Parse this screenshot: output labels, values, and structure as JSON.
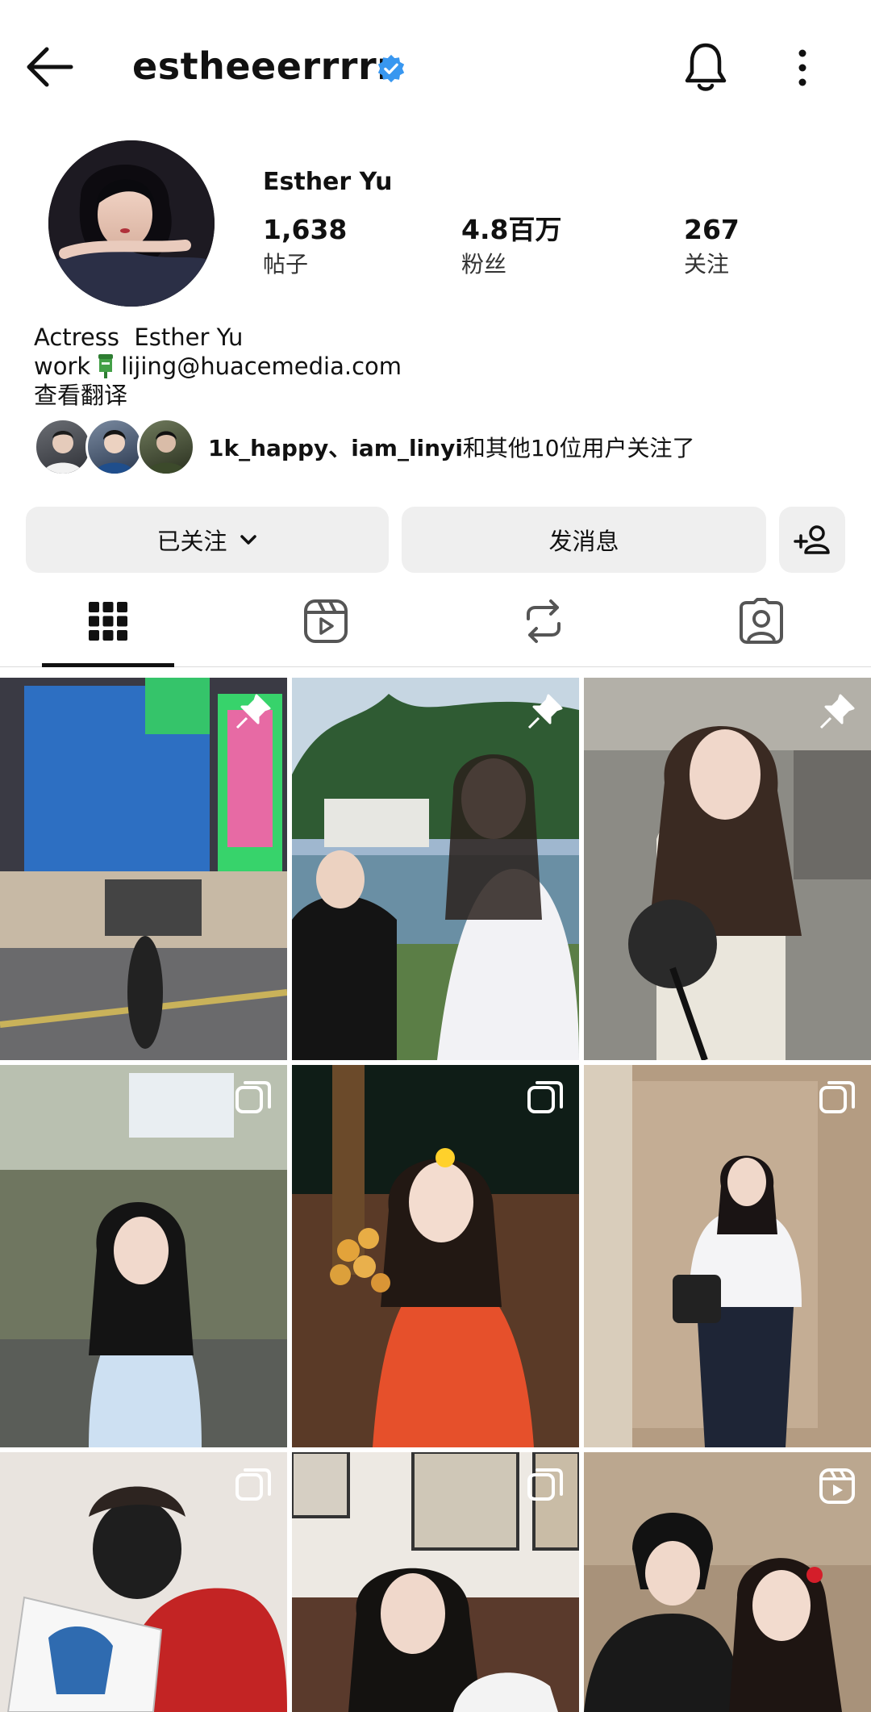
{
  "header": {
    "username": "estheeerrrrr",
    "back_icon": "arrow-left-icon",
    "verified_icon": "verified-badge-icon",
    "bell_icon": "bell-icon",
    "more_icon": "more-vertical-icon"
  },
  "profile": {
    "display_name": "Esther Yu",
    "stats": [
      {
        "value": "1,638",
        "label": "帖子"
      },
      {
        "value": "4.8百万",
        "label": "粉丝"
      },
      {
        "value": "267",
        "label": "关注"
      }
    ],
    "bio_line1": "Actress  Esther Yu",
    "bio_line2_prefix": "work",
    "bio_line2_email": "lijing@huacemedia.com",
    "bio_translate": "查看翻译",
    "mutual_names": "1k_happy、iam_linyi",
    "mutual_suffix": "和其他10位用户关注了"
  },
  "actions": {
    "following_label": "已关注",
    "message_label": "发消息",
    "add_user_icon": "add-person-icon"
  },
  "tabs": [
    {
      "name": "grid",
      "icon": "grid-icon",
      "active": true
    },
    {
      "name": "reels",
      "icon": "reels-icon",
      "active": false
    },
    {
      "name": "reposts",
      "icon": "repost-icon",
      "active": false
    },
    {
      "name": "tagged",
      "icon": "tagged-person-icon",
      "active": false
    }
  ],
  "grid": [
    {
      "badge": "pin-icon"
    },
    {
      "badge": "pin-icon"
    },
    {
      "badge": "pin-icon"
    },
    {
      "badge": "carousel-icon"
    },
    {
      "badge": "carousel-icon"
    },
    {
      "badge": "carousel-icon"
    },
    {
      "badge": "carousel-icon"
    },
    {
      "badge": "carousel-icon"
    },
    {
      "badge": "reel-icon"
    }
  ],
  "colors": {
    "accent_verified": "#3897f0",
    "button_bg": "#efefef",
    "text": "#111111"
  }
}
